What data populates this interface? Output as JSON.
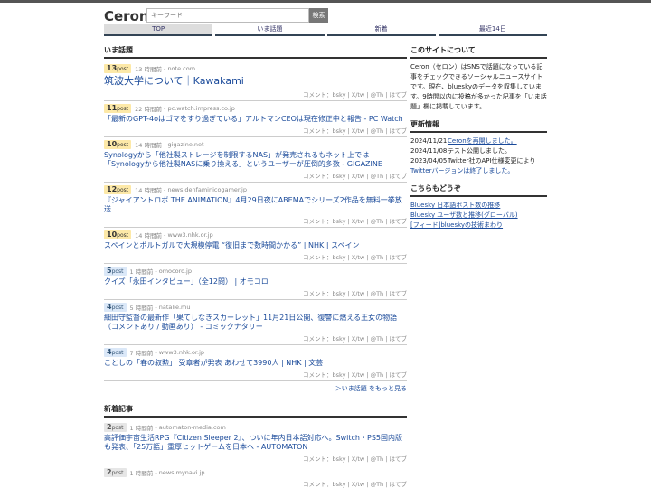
{
  "header": {
    "logo": "Ceron",
    "search_placeholder": "キーワード",
    "search_button": "検索"
  },
  "nav": [
    "TOP",
    "いま話題",
    "新着",
    "最近14日"
  ],
  "trending": {
    "title": "いま話題",
    "more": "＞いま話題 をもっと見る",
    "items": [
      {
        "count": "13",
        "unit": "post",
        "time": "13 時間前",
        "source": "note.com",
        "title": "筑波大学について｜Kawakami"
      },
      {
        "count": "11",
        "unit": "post",
        "time": "22 時間前",
        "source": "pc.watch.impress.co.jp",
        "title": "「最新のGPT-4oはゴマをすり過ぎている」アルトマンCEOは現在修正中と報告 - PC Watch"
      },
      {
        "count": "10",
        "unit": "post",
        "time": "14 時間前",
        "source": "gigazine.net",
        "title": "Synologyから「他社製ストレージを制限するNAS」が発売されるもネット上では「Synologyから他社製NASに乗り換える」というユーザーが圧倒的多数 - GIGAZINE"
      },
      {
        "count": "12",
        "unit": "post",
        "time": "14 時間前",
        "source": "news.denfaminicogamer.jp",
        "title": "『ジャイアントロボ THE ANIMATION』4月29日夜にABEMAでシリーズ2作品を無料一挙放送"
      },
      {
        "count": "10",
        "unit": "post",
        "time": "14 時間前",
        "source": "www3.nhk.or.jp",
        "title": "スペインとポルトガルで大規模停電 “復旧まで数時間かかる” | NHK | スペイン"
      },
      {
        "count": "5",
        "unit": "post",
        "time": "1 時間前",
        "source": "omocoro.jp",
        "title": "クイズ「永田インタビュー」（全12問） | オモコロ"
      },
      {
        "count": "4",
        "unit": "post",
        "time": "5 時間前",
        "source": "natalie.mu",
        "title": "細田守監督の最新作「果てしなきスカーレット」11月21日公開、復讐に燃える王女の物語（コメントあり / 動画あり） - コミックナタリー"
      },
      {
        "count": "4",
        "unit": "post",
        "time": "7 時間前",
        "source": "www3.nhk.or.jp",
        "title": "ことしの「春の叙勲」 受章者が発表 あわせて3990人 | NHK | 文芸"
      }
    ]
  },
  "latest": {
    "title": "新着記事",
    "items": [
      {
        "count": "2",
        "unit": "post",
        "time": "1 時間前",
        "source": "automaton-media.com",
        "title": "高評価宇宙生活RPG『Citizen Sleeper 2』、ついに年内日本語対応へ。Switch・PS5国内版も発表、「25万語」重厚ヒットゲームを日本へ - AUTOMATON"
      },
      {
        "count": "2",
        "unit": "post",
        "time": "1 時間前",
        "source": "news.mynavi.jp",
        "title": ""
      }
    ]
  },
  "actions": "コメント：bsky | X/tw | @Th | はてブ",
  "sidebar": {
    "about_title": "このサイトについて",
    "about_text": "Ceron（セロン）はSNSで話題になっている記事をチェックできるソーシャルニュースサイトです。現在、blueskyのデータを収集しています。9時間以内に投稿が多かった記事を「いま話題」欄に掲載しています。",
    "updates_title": "更新情報",
    "updates": [
      {
        "date": "2024/11/21",
        "text": "Ceronを再開しました。",
        "link": true
      },
      {
        "date": "2024/11/08",
        "text": "テスト公開しました。",
        "link": false
      },
      {
        "date": "2023/04/05",
        "text": "Twitter社のAPI仕様変更により",
        "link": false
      }
    ],
    "updates_extra": "Twitterバージョンは終了しました。",
    "also_title": "こちらもどうぞ",
    "also_links": [
      "Bluesky 日本語ポスト数の推移",
      "Bluesky ユーザ数と推移(グローバル)",
      "[フィード]blueskyの技術まわり"
    ]
  }
}
